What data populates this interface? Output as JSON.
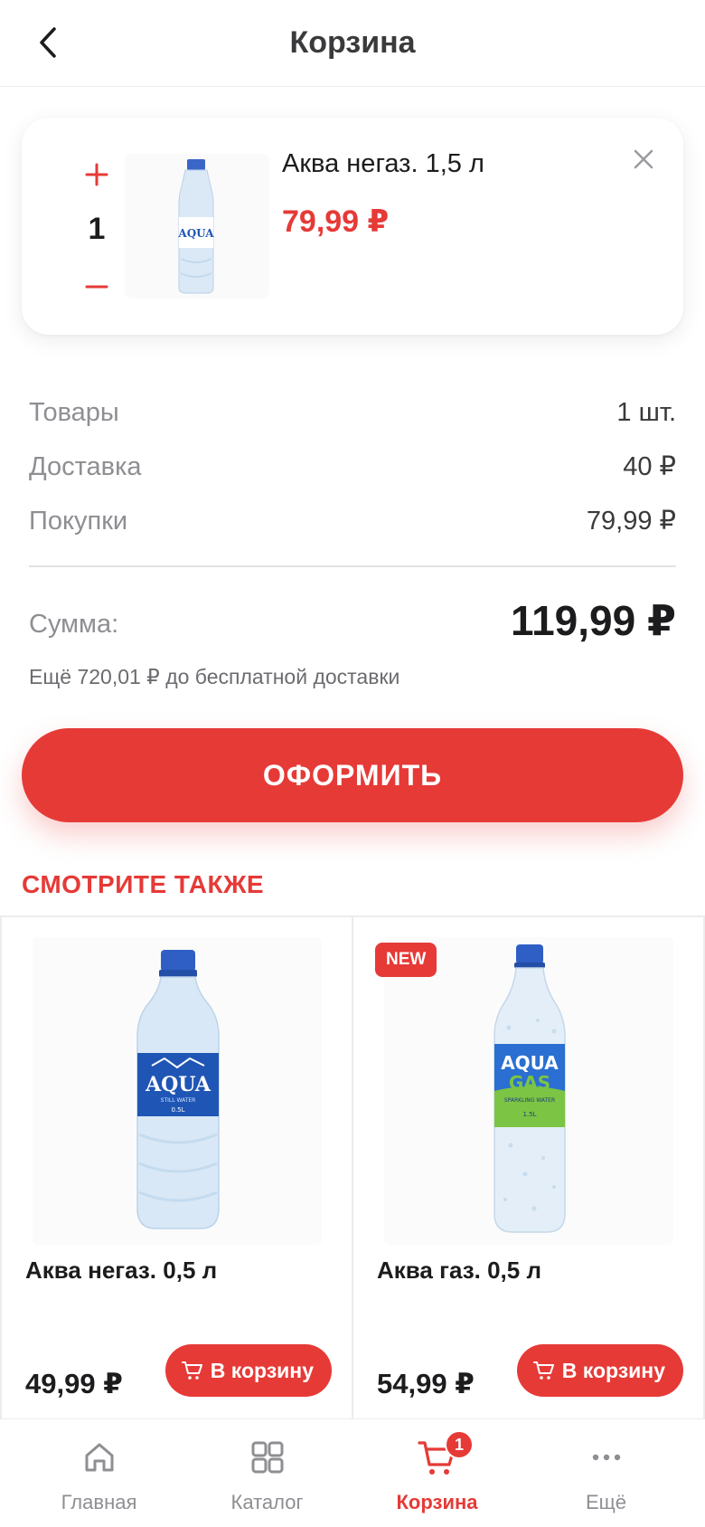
{
  "header": {
    "title": "Корзина"
  },
  "cart_item": {
    "quantity": "1",
    "name": "Аква негаз. 1,5 л",
    "price": "79,99 ₽",
    "image_brand": "AQUA"
  },
  "summary": {
    "goods_label": "Товары",
    "goods_value": "1 шт.",
    "delivery_label": "Доставка",
    "delivery_value": "40 ₽",
    "purchases_label": "Покупки",
    "purchases_value": "79,99 ₽",
    "total_label": "Сумма:",
    "total_value": "119,99 ₽",
    "free_delivery_note": "Ещё 720,01 ₽ до бесплатной доставки"
  },
  "checkout_label": "ОФОРМИТЬ",
  "see_also": {
    "title": "СМОТРИТЕ ТАКЖЕ",
    "products": [
      {
        "name": "Аква негаз. 0,5 л",
        "price": "49,99 ₽",
        "button": "В корзину",
        "badge": "",
        "brand": "AQUA",
        "sub": "STILL WATER",
        "size": "0.5L"
      },
      {
        "name": "Аква газ. 0,5 л",
        "price": "54,99 ₽",
        "button": "В корзину",
        "badge": "NEW",
        "brand": "AQUA",
        "brand2": "GAS",
        "sub": "SPARKLING WATER",
        "size": "1.5L"
      }
    ]
  },
  "tabbar": {
    "items": [
      {
        "label": "Главная",
        "icon": "home-icon"
      },
      {
        "label": "Каталог",
        "icon": "grid-icon"
      },
      {
        "label": "Корзина",
        "icon": "cart-icon",
        "active": true
      },
      {
        "label": "Ещё",
        "icon": "more-icon"
      }
    ],
    "cart_count": "1"
  },
  "colors": {
    "accent": "#e63a37",
    "muted": "#8e8e93",
    "text": "#1c1c1e"
  }
}
